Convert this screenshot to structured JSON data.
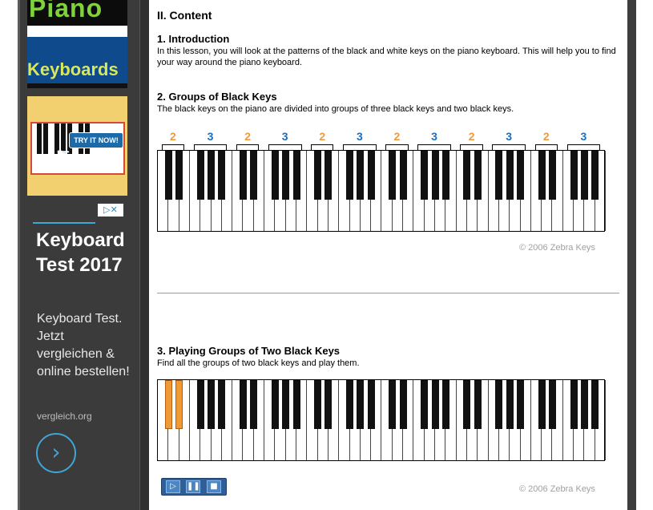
{
  "sidebar": {
    "banner": {
      "top_text": "Piano",
      "bottom_text": "Keyboards"
    },
    "ad_image": {
      "button_label": "TRY IT NOW!"
    },
    "ad": {
      "title": "Keyboard Test 2017",
      "description": "Keyboard Test. Jetzt vergleichen & online bestellen!",
      "url": "vergleich.org",
      "adchoices_label": "▷✕"
    }
  },
  "main": {
    "section_title": "II. Content",
    "intro": {
      "heading": "1. Introduction",
      "text": "In this lesson, you will look at the patterns of the black and white keys on the piano keyboard. This will help you to find your way around the piano keyboard."
    },
    "groups": {
      "heading": "2. Groups of Black Keys",
      "text": "The black keys on the piano are divided into groups of three black keys and two black keys.",
      "group_labels": [
        "2",
        "3",
        "2",
        "3",
        "2",
        "3",
        "2",
        "3",
        "2",
        "3",
        "2",
        "3"
      ],
      "copyright": "© 2006 Zebra Keys"
    },
    "playing": {
      "heading": "3. Playing Groups of Two Black Keys",
      "text": "Find all the groups of two black keys and play them.",
      "copyright": "© 2006 Zebra Keys",
      "highlighted_keys": 2,
      "highlight_color": "#f19a34"
    },
    "controls": {
      "play_icon": "▷",
      "pause_icon": "❚❚",
      "stop_icon": "■"
    }
  },
  "colors": {
    "group_two": "#f09a3a",
    "group_three": "#1a6cc0",
    "sidebar_bg": "#3b3b3b"
  }
}
